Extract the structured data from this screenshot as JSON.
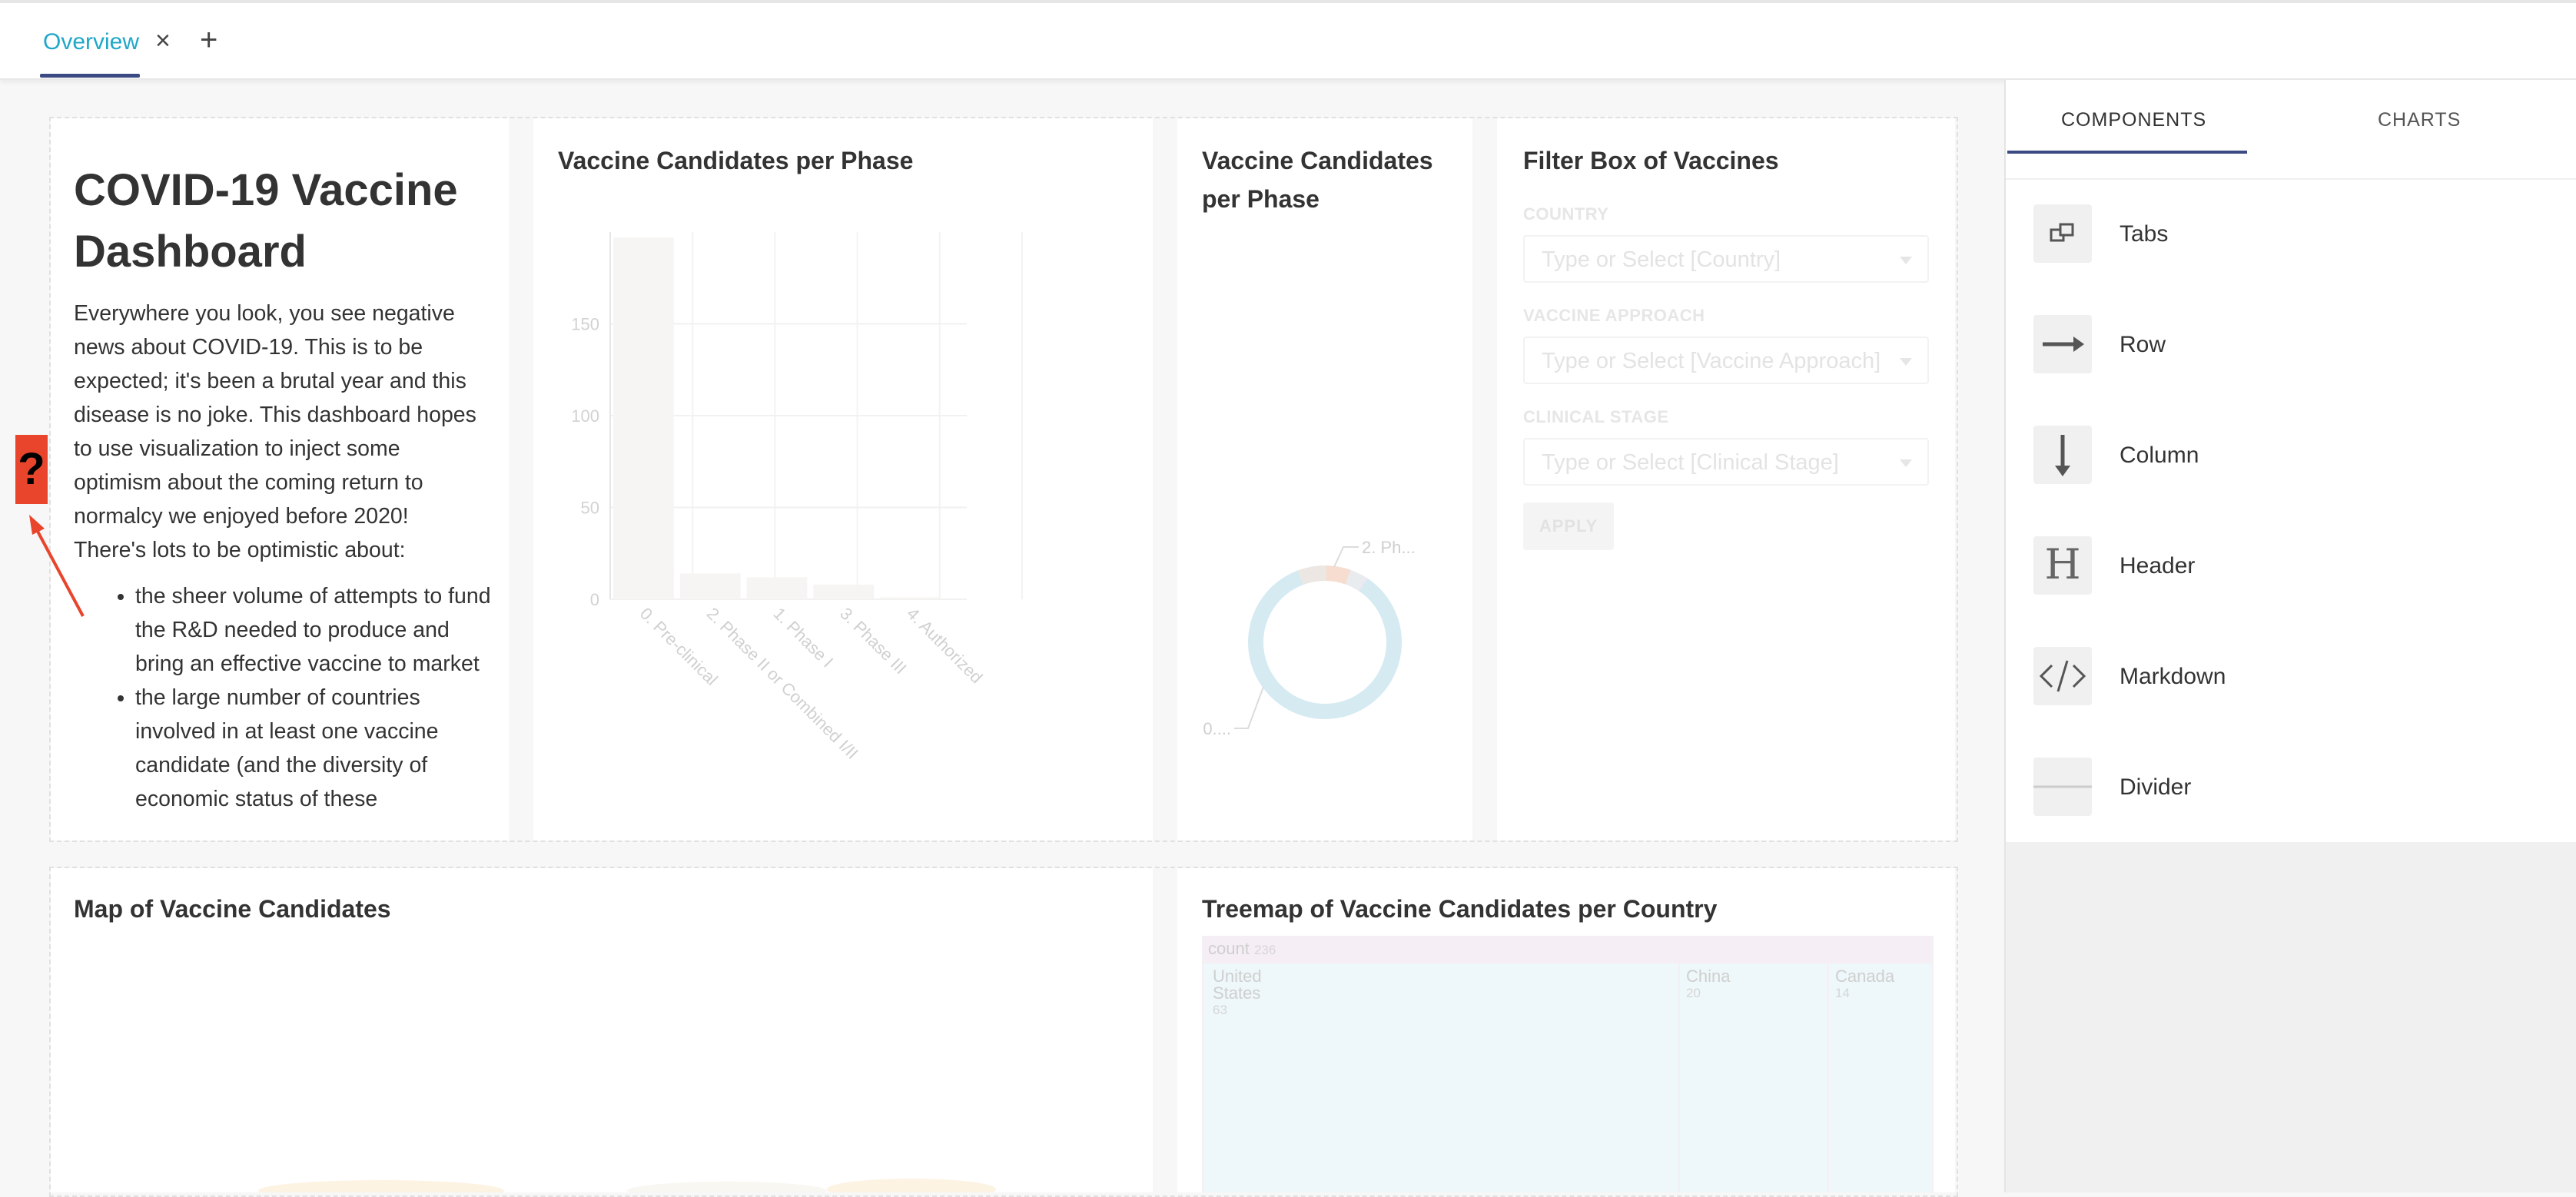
{
  "tabs": {
    "active": "Overview",
    "close": "×",
    "add": "+"
  },
  "help_badge": "?",
  "markdown": {
    "title": "COVID-19 Vaccine Dashboard",
    "intro": "Everywhere you look, you see negative news about COVID-19. This is to be expected; it's been a brutal year and this disease is no joke. This dashboard hopes to use visualization to inject some optimism about the coming return to normalcy we enjoyed before 2020! There's lots to be optimistic about:",
    "bullets": [
      "the sheer volume of attempts to fund the R&D needed to produce and bring an effective vaccine to market",
      "the large number of countries involved in at least one vaccine candidate (and the diversity of economic status of these"
    ]
  },
  "bar_chart": {
    "title": "Vaccine Candidates per Phase",
    "chart_data": {
      "type": "bar",
      "categories": [
        "0. Pre-clinical",
        "2. Phase II or Combined I/II",
        "1. Phase I",
        "3. Phase III",
        "4. Authorized"
      ],
      "values": [
        197,
        14,
        12,
        8,
        1
      ],
      "y_ticks": [
        0,
        50,
        100,
        150
      ],
      "ylim": [
        0,
        200
      ],
      "grid": true
    }
  },
  "pie_chart": {
    "title": "Vaccine Candidates per Phase",
    "labels": [
      "2. Ph...",
      "0...."
    ],
    "chart_data": {
      "type": "pie",
      "donut": true,
      "slices": [
        {
          "label": "0....",
          "value": 197,
          "color": "#d6eaf2"
        },
        {
          "label": "2. Ph...",
          "value": 14,
          "color": "#ece7e2"
        },
        {
          "label": "",
          "value": 12,
          "color": "#f7dcd0"
        },
        {
          "label": "",
          "value": 8,
          "color": "#e9ecef"
        },
        {
          "label": "",
          "value": 1,
          "color": "#efe6f3"
        }
      ]
    }
  },
  "filter_box": {
    "title": "Filter Box of Vaccines",
    "fields": [
      {
        "label": "COUNTRY",
        "placeholder": "Type or Select [Country]"
      },
      {
        "label": "VACCINE APPROACH",
        "placeholder": "Type or Select [Vaccine Approach]"
      },
      {
        "label": "CLINICAL STAGE",
        "placeholder": "Type or Select [Clinical Stage]"
      }
    ],
    "apply": "APPLY"
  },
  "map": {
    "title": "Map of Vaccine Candidates"
  },
  "treemap": {
    "title": "Treemap of Vaccine Candidates per Country",
    "root": {
      "label": "count",
      "value": "236"
    },
    "nodes": [
      {
        "label_line1": "United",
        "label_line2": "States",
        "value": "63"
      },
      {
        "label_line1": "China",
        "label_line2": "",
        "value": "20"
      },
      {
        "label_line1": "Canada",
        "label_line2": "",
        "value": "14"
      }
    ]
  },
  "builder_panel": {
    "tabs": [
      "COMPONENTS",
      "CHARTS"
    ],
    "components": [
      "Tabs",
      "Row",
      "Column",
      "Header",
      "Markdown",
      "Divider"
    ]
  },
  "colors": {
    "accent": "#20a7c9",
    "tab_underline": "#3b4a82",
    "help_badge": "#e8452c"
  }
}
